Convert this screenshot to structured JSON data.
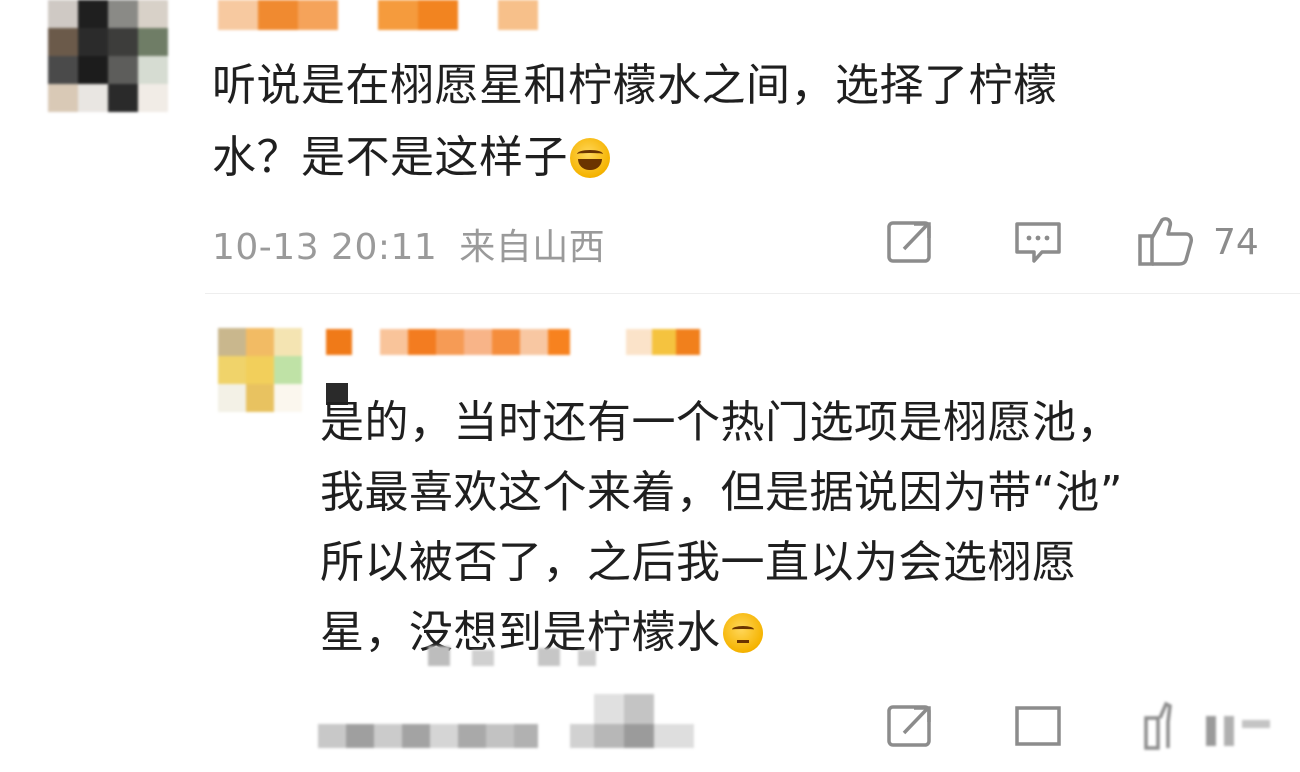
{
  "comment": {
    "text_line1": "听说是在栩愿星和柠檬水之间，选择了柠檬",
    "text_line2": "水？是不是这样子",
    "emoji": "laughing-tears-emoji",
    "timestamp": "10-13 20:11",
    "location": "来自山西",
    "like_count": "74"
  },
  "reply": {
    "line1": "是的，当时还有一个热门选项是栩愿池，",
    "line2": "我最喜欢这个来着，但是据说因为带“池”",
    "line3": "所以被否了，之后我一直以为会选栩愿",
    "line4": "星，没想到是柠檬水",
    "emoji": "thinking-emoji"
  },
  "icons": {
    "share": "share-icon",
    "comment": "comment-icon",
    "like": "thumbs-up-icon"
  },
  "colors": {
    "text": "#1f1f1f",
    "meta": "#9a9a9a",
    "icon": "#8c8c8c",
    "blur_orange": "#f07a18"
  }
}
